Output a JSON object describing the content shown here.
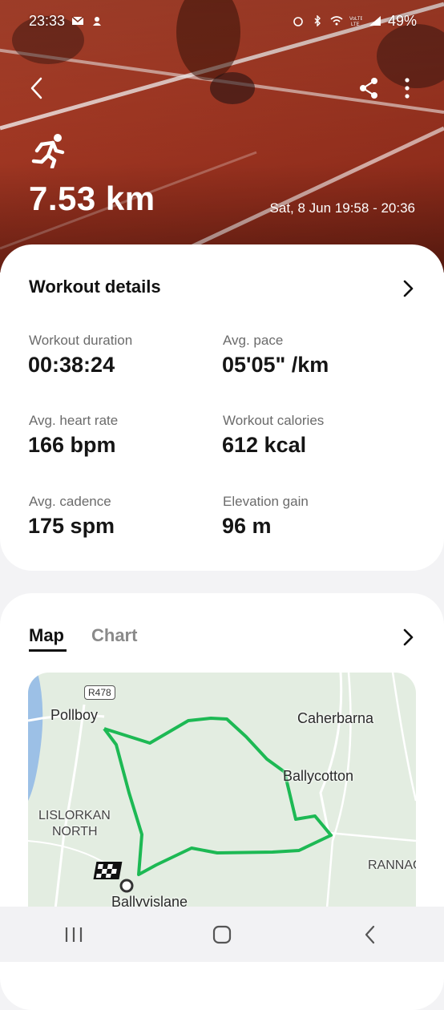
{
  "status_bar": {
    "time": "23:33",
    "battery": "49%",
    "icons": [
      "mail-icon",
      "notification-icon",
      "alarm-icon",
      "bluetooth-icon",
      "wifi-icon",
      "volte-icon",
      "signal-icon"
    ]
  },
  "header": {
    "activity_icon": "running-icon",
    "distance": "7.53 km",
    "datetime": "Sat, 8 Jun 19:58 - 20:36"
  },
  "workout_details": {
    "title": "Workout details",
    "stats": [
      {
        "label": "Workout duration",
        "value": "00:38:24"
      },
      {
        "label": "Avg. pace",
        "value": "05'05\" /km"
      },
      {
        "label": "Avg. heart rate",
        "value": "166 bpm"
      },
      {
        "label": "Workout calories",
        "value": "612 kcal"
      },
      {
        "label": "Avg. cadence",
        "value": "175 spm"
      },
      {
        "label": "Elevation gain",
        "value": "96 m"
      }
    ]
  },
  "map_section": {
    "tabs": [
      {
        "label": "Map",
        "active": true
      },
      {
        "label": "Chart",
        "active": false
      }
    ],
    "road_badge": "R478",
    "places": {
      "pollboy": "Pollboy",
      "caherbarna": "Caherbarna",
      "ballycotton": "Ballycotton",
      "lislorkan": "LISLORKAN",
      "lislorkan_north": "NORTH",
      "rannag": "RANNAG",
      "ballyvislane": "Ballyvislane"
    },
    "route_color": "#1db954"
  },
  "colors": {
    "accent": "#1db954",
    "hero": "#a63a25"
  }
}
